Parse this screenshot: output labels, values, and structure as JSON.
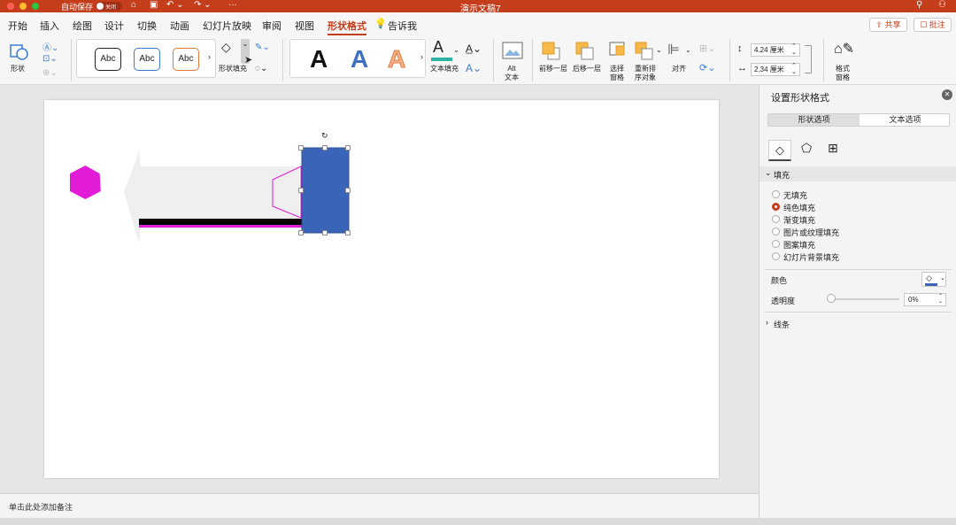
{
  "titlebar": {
    "autosave_label": "自动保存",
    "autosave_state": "关闭",
    "doc_title": "演示文稿7"
  },
  "tabs": [
    "开始",
    "插入",
    "绘图",
    "设计",
    "切换",
    "动画",
    "幻灯片放映",
    "审阅",
    "视图",
    "形状格式",
    "告诉我"
  ],
  "share_button": "共享",
  "comment_button": "批注",
  "ribbon": {
    "shape_label": "形状",
    "style_samples": [
      "Abc",
      "Abc",
      "Abc"
    ],
    "shape_fill_label": "形状填充",
    "wordart_samples": [
      "A",
      "A",
      "A"
    ],
    "text_fill_label": "文本填充",
    "alt_text_label": "Alt\n文本",
    "bring_forward_label": "前移一层",
    "send_backward_label": "后移一层",
    "selection_pane_label": "选择\n窗格",
    "reorder_label": "重新排\n序对象",
    "align_label": "对齐",
    "height_value": "4.24 厘米",
    "width_value": "2.34 厘米",
    "format_pane_label": "格式\n窗格"
  },
  "notes_placeholder": "单击此处添加备注",
  "pane": {
    "title": "设置形状格式",
    "tab_shape": "形状选项",
    "tab_text": "文本选项",
    "fill_section": "填充",
    "fill_options": [
      "无填充",
      "纯色填充",
      "渐变填充",
      "图片或纹理填充",
      "图案填充",
      "幻灯片背景填充"
    ],
    "fill_selected_index": 1,
    "color_label": "颜色",
    "transparency_label": "透明度",
    "transparency_value": "0%",
    "line_section": "线条"
  },
  "colors": {
    "accent": "#c43e1c",
    "shape_blue": "#3a64b8",
    "magenta": "#e21bd6"
  }
}
